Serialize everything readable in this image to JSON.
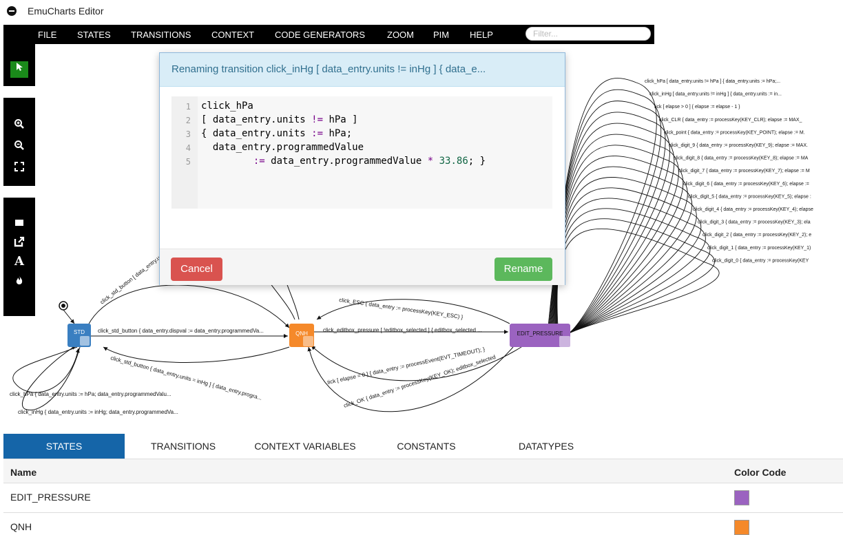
{
  "window": {
    "title": "EmuCharts Editor"
  },
  "menu": [
    "FILE",
    "STATES",
    "TRANSITIONS",
    "CONTEXT",
    "CODE GENERATORS",
    "ZOOM",
    "PIM",
    "HELP"
  ],
  "filter": {
    "placeholder": "Filter..."
  },
  "toolbar": {
    "tools": [
      "pointer-tool",
      "zoom-in",
      "zoom-out",
      "zoom-fit",
      "add-state",
      "add-transition",
      "add-text",
      "delete"
    ]
  },
  "diagram": {
    "states": [
      {
        "name": "STD",
        "color": "#3a7fc1"
      },
      {
        "name": "QNH",
        "color": "#f5892a"
      },
      {
        "name": "EDIT_PRESSURE",
        "color": "#9b63c0"
      }
    ],
    "fanout_labels": [
      "click_hPa [ data_entry.units != hPa ] { data_entry.units := hPa;...",
      "click_inHg [ data_entry.units != inHg ] { data_entry.units := in...",
      "tick [ elapse > 0 ] { elapse := elapse - 1 }",
      "click_CLR { data_entry := processKey(KEY_CLR); elapse := MAX_",
      "click_point { data_entry := processKey(KEY_POINT); elapse := M.",
      "click_digit_9 { data_entry := processKey(KEY_9); elapse := MAX.",
      "click_digit_8 { data_entry := processKey(KEY_8); elapse := MA",
      "click_digit_7 { data_entry := processKey(KEY_7); elapse := M",
      "click_digit_6 { data_entry := processKey(KEY_6); elapse := ",
      "click_digit_5 { data_entry := processKey(KEY_5); elapse :",
      "click_digit_4 { data_entry := processKey(KEY_4); elapse",
      "click_digit_3 { data_entry := processKey(KEY_3); ela",
      "click_digit_2 { data_entry := processKey(KEY_2); e",
      "click_digit_1 { data_entry := processKey(KEY_1)",
      "click_digit_0 { data_entry := processKey(KEY"
    ],
    "edge_labels": {
      "std_to_qnh": "click_std_button { data_entry.dispval := data_entry.programmedVa...",
      "qnh_to_std": "click_std_button { data_entry.units = inHg ] { data_entry.progra...",
      "std_arc_top": "click_std_button [ data_entry.units = hPa ] { data_entry.program...",
      "qnh_to_edit": "click_editbox_pressure [ !editbox_selected ] { editbox_selected ...",
      "edit_to_qnh_esc": "click_ESC { data_entry := processKey(KEY_ESC) }",
      "tick_timeout": "tick [ elapse = 0 ] { data_entry := processEvent(EVT_TIMEOUT); }",
      "click_ok": "click_OK { data_entry := processKey(KEY_OK); editbox_selected",
      "std_self_hpa": "click_hPa { data_entry.units := hPa; data_entry.programmedValu...",
      "std_self_inhg": "click_inHg { data_entry.units := inHg; data_entry.programmedVa..."
    }
  },
  "modal": {
    "title": "Renaming transition click_inHg [ data_entry.units != inHg ] { data_e...",
    "line_numbers": [
      "1",
      "2",
      "3",
      "4",
      "5"
    ],
    "code": {
      "line1": "click_hPa",
      "line2_pre": "[ data_entry.units ",
      "line2_op": "!=",
      "line2_post": " hPa ]",
      "line3_pre": "{ data_entry.units ",
      "line3_op": ":=",
      "line3_post": " hPa;",
      "line4": "  data_entry.programmedValue",
      "line5_op": "         :=",
      "line5_mid": " data_entry.programmedValue ",
      "line5_op2": "*",
      "line5_num": " 33.86",
      "line5_post": "; }"
    },
    "cancel_label": "Cancel",
    "rename_label": "Rename"
  },
  "tabs": [
    "STATES",
    "TRANSITIONS",
    "CONTEXT VARIABLES",
    "CONSTANTS",
    "DATATYPES"
  ],
  "table": {
    "headers": {
      "name": "Name",
      "color": "Color Code"
    },
    "rows": [
      {
        "name": "EDIT_PRESSURE",
        "color": "#9b63c0"
      },
      {
        "name": "QNH",
        "color": "#f5892a"
      }
    ]
  }
}
